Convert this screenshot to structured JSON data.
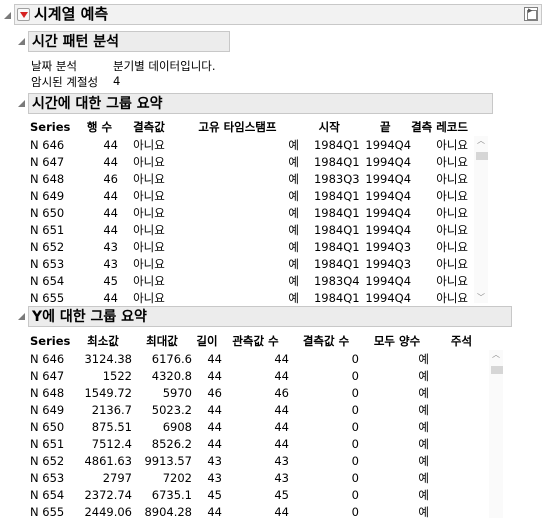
{
  "window": {
    "title": "시계열 예측"
  },
  "time_pattern": {
    "heading": "시간 패턴 분석",
    "date_label": "날짜 분석",
    "date_value": "분기별 데이터입니다.",
    "season_label": "암시된 계절성",
    "season_value": "4"
  },
  "time_summary": {
    "heading": "시간에 대한 그룹 요약",
    "columns": [
      "Series",
      "행 수",
      "결측값",
      "고유 타임스탬프",
      "시작",
      "끝",
      "결측 레코드"
    ],
    "rows": [
      [
        "N 646",
        "44",
        "아니요",
        "예",
        "1984Q1",
        "1994Q4",
        "아니요"
      ],
      [
        "N 647",
        "44",
        "아니요",
        "예",
        "1984Q1",
        "1994Q4",
        "아니요"
      ],
      [
        "N 648",
        "46",
        "아니요",
        "예",
        "1983Q3",
        "1994Q4",
        "아니요"
      ],
      [
        "N 649",
        "44",
        "아니요",
        "예",
        "1984Q1",
        "1994Q4",
        "아니요"
      ],
      [
        "N 650",
        "44",
        "아니요",
        "예",
        "1984Q1",
        "1994Q4",
        "아니요"
      ],
      [
        "N 651",
        "44",
        "아니요",
        "예",
        "1984Q1",
        "1994Q4",
        "아니요"
      ],
      [
        "N 652",
        "43",
        "아니요",
        "예",
        "1984Q1",
        "1994Q3",
        "아니요"
      ],
      [
        "N 653",
        "43",
        "아니요",
        "예",
        "1984Q1",
        "1994Q3",
        "아니요"
      ],
      [
        "N 654",
        "45",
        "아니요",
        "예",
        "1983Q4",
        "1994Q4",
        "아니요"
      ],
      [
        "N 655",
        "44",
        "아니요",
        "예",
        "1984Q1",
        "1994Q4",
        "아니요"
      ]
    ]
  },
  "y_summary": {
    "heading": "Y에 대한 그룹 요약",
    "columns": [
      "Series",
      "최소값",
      "최대값",
      "길이",
      "관측값 수",
      "결측값 수",
      "모두 양수",
      "주석"
    ],
    "rows": [
      [
        "N 646",
        "3124.38",
        "6176.6",
        "44",
        "44",
        "0",
        "예",
        ""
      ],
      [
        "N 647",
        "1522",
        "4320.8",
        "44",
        "44",
        "0",
        "예",
        ""
      ],
      [
        "N 648",
        "1549.72",
        "5970",
        "46",
        "46",
        "0",
        "예",
        ""
      ],
      [
        "N 649",
        "2136.7",
        "5023.2",
        "44",
        "44",
        "0",
        "예",
        ""
      ],
      [
        "N 650",
        "875.51",
        "6908",
        "44",
        "44",
        "0",
        "예",
        ""
      ],
      [
        "N 651",
        "7512.4",
        "8526.2",
        "44",
        "44",
        "0",
        "예",
        ""
      ],
      [
        "N 652",
        "4861.63",
        "9913.57",
        "43",
        "43",
        "0",
        "예",
        ""
      ],
      [
        "N 653",
        "2797",
        "7202",
        "43",
        "43",
        "0",
        "예",
        ""
      ],
      [
        "N 654",
        "2372.74",
        "6735.1",
        "45",
        "45",
        "0",
        "예",
        ""
      ],
      [
        "N 655",
        "2449.06",
        "8904.28",
        "44",
        "44",
        "0",
        "예",
        ""
      ]
    ]
  }
}
